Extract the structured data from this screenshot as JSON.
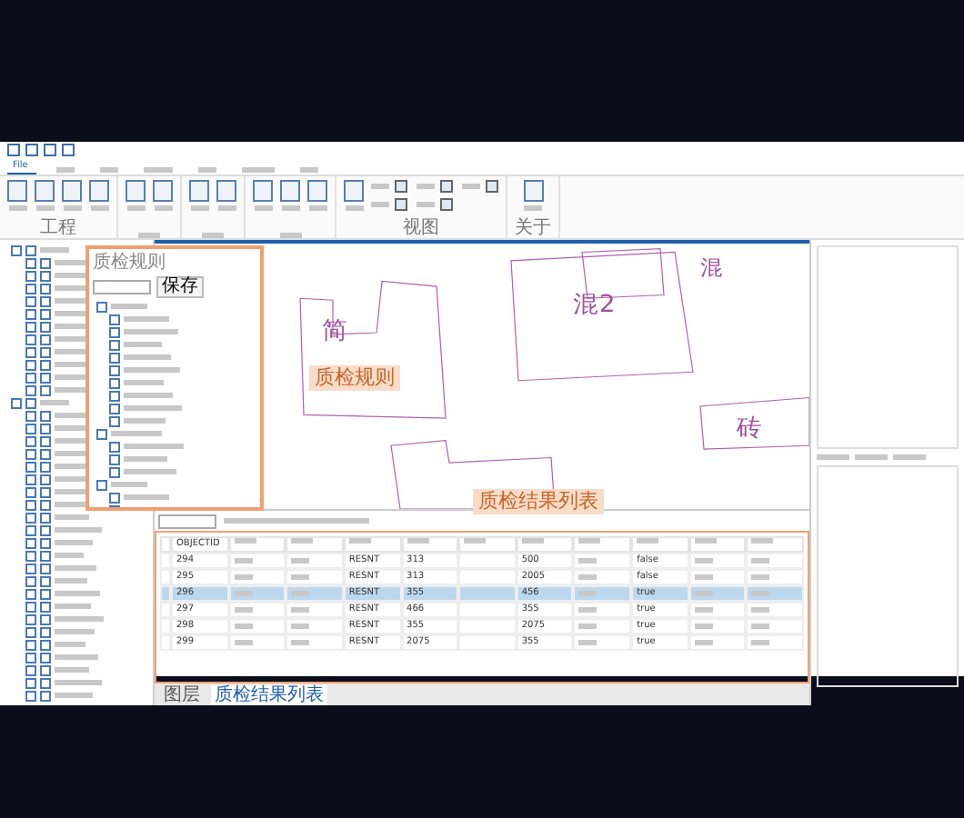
{
  "ribbon": {
    "tabs": [
      {
        "label": "File",
        "selected": true
      },
      {
        "selected": false
      },
      {
        "selected": false
      },
      {
        "selected": false
      },
      {
        "selected": false
      },
      {
        "selected": false
      },
      {
        "selected": false
      }
    ],
    "groups": [
      {
        "label": "工程"
      },
      {
        "label": "视图",
        "checks": [
          true,
          true,
          true,
          true,
          true
        ]
      },
      {
        "label": "关于"
      }
    ]
  },
  "rules_dialog": {
    "title": "质检规则",
    "save": "保存"
  },
  "map": {
    "labels": [
      "简",
      "混2",
      "混",
      "砖"
    ],
    "callouts": [
      {
        "text": "质检规则"
      },
      {
        "text": "质检结果列表"
      }
    ]
  },
  "table": {
    "columns": [
      "OBJECTID"
    ],
    "rows": [
      {
        "selected": false,
        "cells": [
          "294",
          "RESNT",
          "313",
          "500",
          "false"
        ]
      },
      {
        "selected": false,
        "cells": [
          "295",
          "RESNT",
          "313",
          "2005",
          "false"
        ]
      },
      {
        "selected": true,
        "cells": [
          "296",
          "RESNT",
          "355",
          "456",
          "true"
        ]
      },
      {
        "selected": false,
        "cells": [
          "297",
          "RESNT",
          "466",
          "355",
          "true"
        ]
      },
      {
        "selected": false,
        "cells": [
          "298",
          "RESNT",
          "355",
          "2075",
          "true"
        ]
      },
      {
        "selected": false,
        "cells": [
          "299",
          "RESNT",
          "2075",
          "355",
          "true"
        ]
      }
    ]
  },
  "bottom_tabs": [
    {
      "label": "图层",
      "selected": false
    },
    {
      "label": "质检结果列表",
      "selected": true
    }
  ]
}
